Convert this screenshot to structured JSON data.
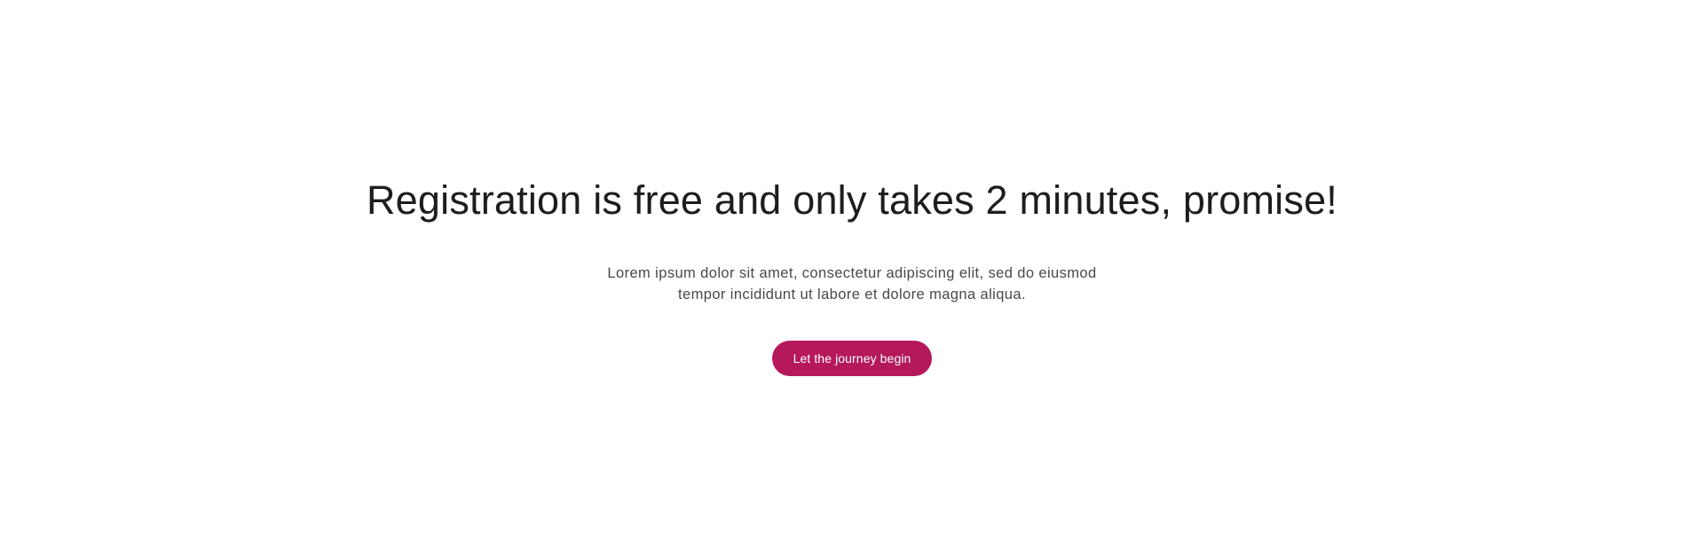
{
  "hero": {
    "title": "Registration is free and only takes 2 minutes, promise!",
    "description_line1": "Lorem ipsum dolor sit amet, consectetur adipiscing elit, sed do eiusmod",
    "description_line2": "tempor incididunt ut labore et dolore magna aliqua.",
    "cta_label": "Let the journey begin"
  },
  "colors": {
    "background": "#ffffff",
    "title": "#1e1c1f",
    "body_text": "#4b474c",
    "accent": "#b5195b",
    "button_text": "#ffffff"
  }
}
